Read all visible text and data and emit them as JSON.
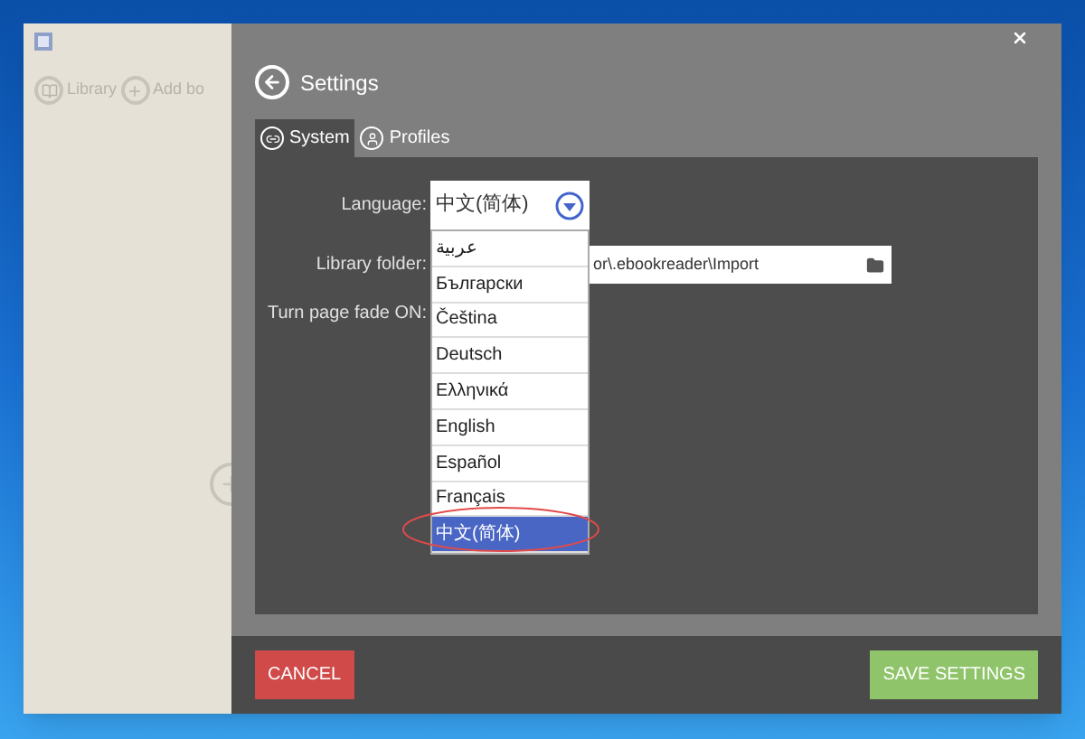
{
  "sidebar": {
    "toolbar": [
      {
        "label": "Library"
      },
      {
        "label": "Add bo"
      }
    ]
  },
  "settings": {
    "title": "Settings",
    "tabs": [
      {
        "label": "System",
        "selected": true
      },
      {
        "label": "Profiles",
        "selected": false
      }
    ],
    "language": {
      "label": "Language:",
      "value": "中文(简体)",
      "expanded": true,
      "options": [
        {
          "label": "عربية",
          "selected": false
        },
        {
          "label": "Български",
          "selected": false
        },
        {
          "label": "Čeština",
          "selected": false
        },
        {
          "label": "Deutsch",
          "selected": false
        },
        {
          "label": "Ελληνικά",
          "selected": false
        },
        {
          "label": "English",
          "selected": false
        },
        {
          "label": "Español",
          "selected": false
        },
        {
          "label": "Français",
          "selected": false
        },
        {
          "label": "中文(简体)",
          "selected": true
        }
      ]
    },
    "library_folder": {
      "label": "Library folder:",
      "value": "or\\.ebookreader\\Import"
    },
    "turn_page_fade": {
      "label": "Turn page fade ON:"
    }
  },
  "buttons": {
    "cancel": "CANCEL",
    "save": "SAVE SETTINGS"
  }
}
